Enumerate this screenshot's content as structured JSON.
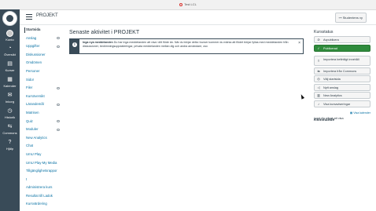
{
  "browser": {
    "recording_label": "Test LCL"
  },
  "global_nav": {
    "items": [
      {
        "label": "Konto",
        "icon": "avatar-icon"
      },
      {
        "label": "Översikt",
        "icon": "dashboard-icon"
      },
      {
        "label": "Kurser",
        "icon": "book-icon"
      },
      {
        "label": "Kalender",
        "icon": "calendar-icon"
      },
      {
        "label": "Inkorg",
        "icon": "inbox-icon"
      },
      {
        "label": "Historik",
        "icon": "clock-icon"
      },
      {
        "label": "Commons",
        "icon": "commons-icon"
      },
      {
        "label": "Hjälp",
        "icon": "help-icon"
      }
    ]
  },
  "header": {
    "breadcrumb": "PROJEKT",
    "student_view_label": "Studentens vy"
  },
  "course_nav": {
    "items": [
      {
        "label": "Startsida",
        "active": true,
        "hidden": false
      },
      {
        "label": "Anslag",
        "active": false,
        "hidden": true
      },
      {
        "label": "Uppgifter",
        "active": false,
        "hidden": true
      },
      {
        "label": "Diskussioner",
        "active": false,
        "hidden": false
      },
      {
        "label": "Omdömen",
        "active": false,
        "hidden": false
      },
      {
        "label": "Personer",
        "active": false,
        "hidden": false
      },
      {
        "label": "Sidor",
        "active": false,
        "hidden": false
      },
      {
        "label": "Filer",
        "active": false,
        "hidden": true
      },
      {
        "label": "Kursöversikt",
        "active": false,
        "hidden": false
      },
      {
        "label": "Lärandemål",
        "active": false,
        "hidden": true
      },
      {
        "label": "Matrisen",
        "active": false,
        "hidden": false
      },
      {
        "label": "Quiz",
        "active": false,
        "hidden": true
      },
      {
        "label": "Moduler",
        "active": false,
        "hidden": true
      },
      {
        "label": "New Analytics",
        "active": false,
        "hidden": false
      },
      {
        "label": "Chat",
        "active": false,
        "hidden": false
      },
      {
        "label": "UmU Play",
        "active": false,
        "hidden": false
      },
      {
        "label": "UmU Play-My Media",
        "active": false,
        "hidden": false
      },
      {
        "label": "Tillgänglighetsrappor",
        "active": false,
        "hidden": false
      },
      {
        "label": "t",
        "active": false,
        "hidden": false
      },
      {
        "label": "Administrera kurs",
        "active": false,
        "hidden": false
      },
      {
        "label": "Resultat till Ladok",
        "active": false,
        "hidden": false
      },
      {
        "label": "Kursvärdering",
        "active": false,
        "hidden": false
      }
    ]
  },
  "main": {
    "title": "Senaste aktivitet i PROJEKT",
    "alert": {
      "heading": "Inga nya meddelanden",
      "text": "Du har inga meddelanden att visa i ditt flöde än. När du börjar delta i kurser kommer du märka att flödet börjar fyllas med meddelanden från diskussioner, bedömningsuppdateringar, privata meddelanden mellan dig och andra användare, osv.",
      "close": "×"
    }
  },
  "sidebar": {
    "status_heading": "Kursstatus",
    "unpublish_label": "Avpublicera",
    "publish_label": "Publicerad",
    "buttons": [
      {
        "label": "Importera befintligt innehåll",
        "icon": "import-icon"
      },
      {
        "label": "Importera från Commons",
        "icon": "commons-icon"
      },
      {
        "label": "Välj startsida",
        "icon": "target-icon"
      },
      {
        "label": "Nytt anslag",
        "icon": "megaphone-icon"
      },
      {
        "label": "New Analytics",
        "icon": "analytics-icon"
      },
      {
        "label": "Visa kursaviseringar",
        "icon": "bell-icon"
      }
    ],
    "coming_heading": "Kommande",
    "calendar_link": "Visa kalender",
    "nothing_label": "Inget för något att visa"
  }
}
